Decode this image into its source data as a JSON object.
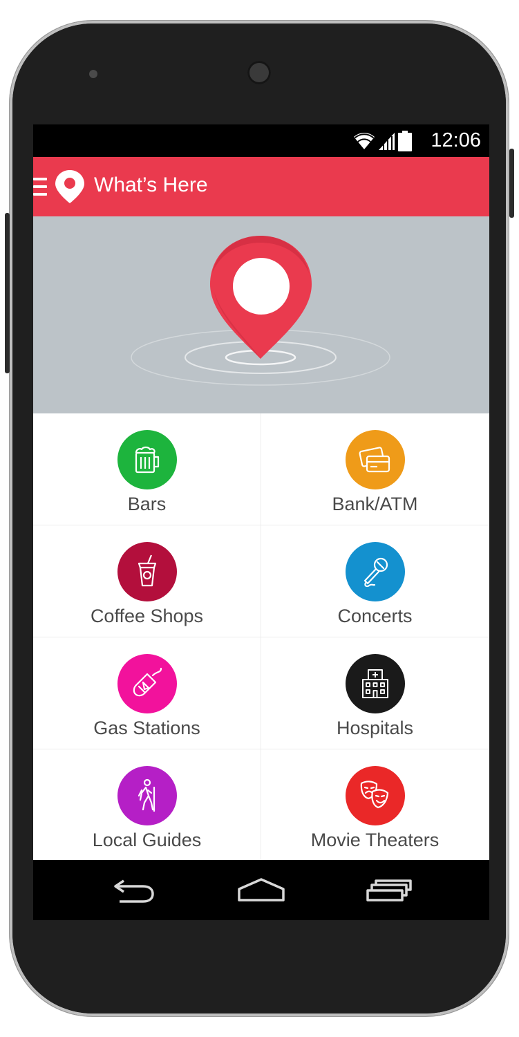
{
  "status_bar": {
    "time": "12:06",
    "icons": [
      "wifi-icon",
      "cell-signal-icon",
      "battery-icon"
    ]
  },
  "app_bar": {
    "title": "What’s Here",
    "color": "#ea3a4e"
  },
  "categories": [
    {
      "label": "Bars",
      "icon": "beer-mug-icon",
      "color": "#1db43d"
    },
    {
      "label": "Bank/ATM",
      "icon": "credit-card-icon",
      "color": "#ef9b19"
    },
    {
      "label": "Coffee Shops",
      "icon": "coffee-cup-icon",
      "color": "#b30f3c"
    },
    {
      "label": "Concerts",
      "icon": "microphone-icon",
      "color": "#1491cf"
    },
    {
      "label": "Gas Stations",
      "icon": "fuel-nozzle-icon",
      "color": "#f2129c"
    },
    {
      "label": "Hospitals",
      "icon": "hospital-building-icon",
      "color": "#1a1a1a"
    },
    {
      "label": "Local Guides",
      "icon": "hiker-icon",
      "color": "#b51fc6"
    },
    {
      "label": "Movie Theaters",
      "icon": "theater-masks-icon",
      "color": "#ea2828"
    }
  ],
  "nav_bar": {
    "buttons": [
      "back-icon",
      "home-icon",
      "recents-icon"
    ]
  }
}
